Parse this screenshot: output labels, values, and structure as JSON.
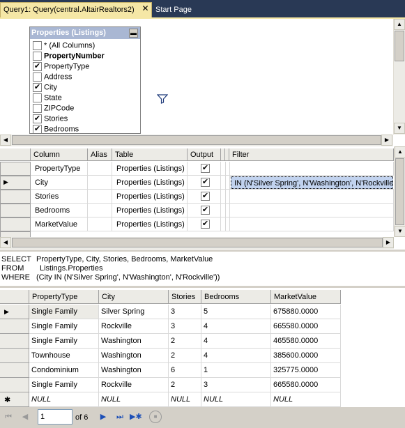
{
  "tabs": {
    "active_label": "Query1: Query(central.AltairRealtors2)",
    "inactive_label": "Start Page"
  },
  "diagram": {
    "table_title": "Properties (Listings)",
    "columns": [
      {
        "label": "* (All Columns)",
        "checked": ""
      },
      {
        "label": "PropertyNumber",
        "checked": ""
      },
      {
        "label": "PropertyType",
        "checked": "✔"
      },
      {
        "label": "Address",
        "checked": ""
      },
      {
        "label": "City",
        "checked": "✔"
      },
      {
        "label": "State",
        "checked": ""
      },
      {
        "label": "ZIPCode",
        "checked": ""
      },
      {
        "label": "Stories",
        "checked": "✔"
      },
      {
        "label": "Bedrooms",
        "checked": "✔"
      }
    ]
  },
  "criteria": {
    "headers": {
      "column": "Column",
      "alias": "Alias",
      "table": "Table",
      "output": "Output",
      "filter": "Filter"
    },
    "rows": [
      {
        "column": "PropertyType",
        "alias": "",
        "table": "Properties (Listings)",
        "output": "✔",
        "filter": ""
      },
      {
        "column": "City",
        "alias": "",
        "table": "Properties (Listings)",
        "output": "✔",
        "filter": "IN (N'Silver Spring', N'Washington', N'Rockville')"
      },
      {
        "column": "Stories",
        "alias": "",
        "table": "Properties (Listings)",
        "output": "✔",
        "filter": ""
      },
      {
        "column": "Bedrooms",
        "alias": "",
        "table": "Properties (Listings)",
        "output": "✔",
        "filter": ""
      },
      {
        "column": "MarketValue",
        "alias": "",
        "table": "Properties (Listings)",
        "output": "✔",
        "filter": ""
      }
    ]
  },
  "sql": {
    "select_kw": "SELECT",
    "select_text": "PropertyType, City, Stories, Bedrooms, MarketValue",
    "from_kw": "FROM",
    "from_text": "Listings.Properties",
    "where_kw": "WHERE",
    "where_text": "(City IN (N'Silver Spring', N'Washington', N'Rockville'))"
  },
  "results": {
    "headers": [
      "PropertyType",
      "City",
      "Stories",
      "Bedrooms",
      "MarketValue"
    ],
    "rows": [
      [
        "Single Family",
        "Silver Spring",
        "3",
        "5",
        "675880.0000"
      ],
      [
        "Single Family",
        "Rockville",
        "3",
        "4",
        "665580.0000"
      ],
      [
        "Single Family",
        "Washington",
        "2",
        "4",
        "465580.0000"
      ],
      [
        "Townhouse",
        "Washington",
        "2",
        "4",
        "385600.0000"
      ],
      [
        "Condominium",
        "Washington",
        "6",
        "1",
        "325775.0000"
      ],
      [
        "Single Family",
        "Rockville",
        "2",
        "3",
        "665580.0000"
      ]
    ],
    "null_label": "NULL",
    "new_row_marker": "✱",
    "current_row_marker": "▶"
  },
  "nav": {
    "page_value": "1",
    "of_label": "of 6"
  }
}
